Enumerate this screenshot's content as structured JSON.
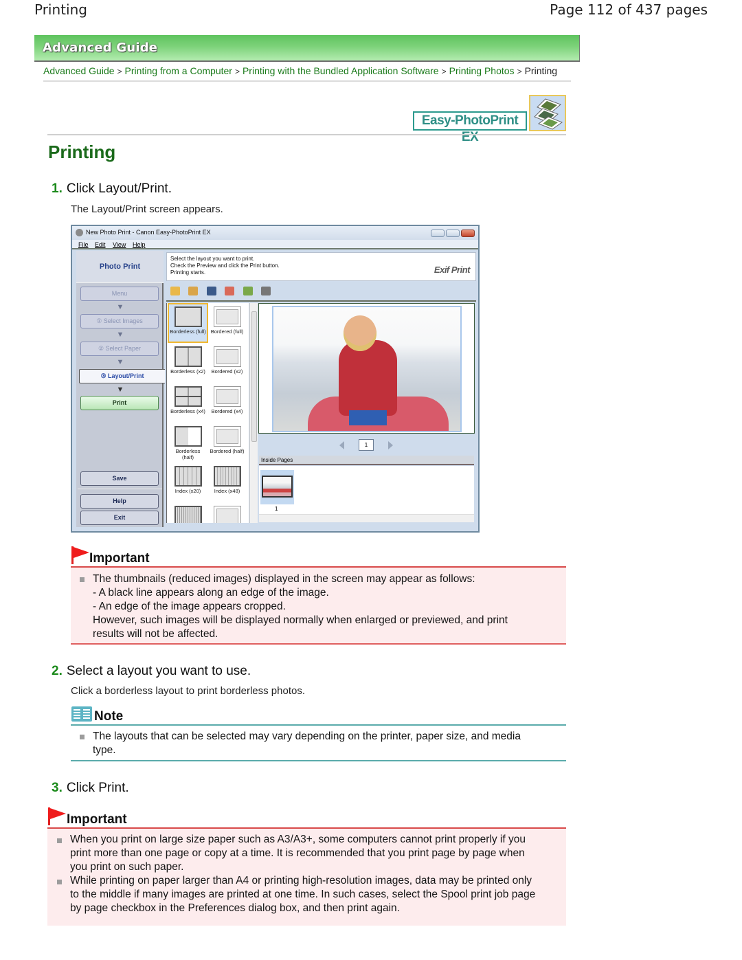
{
  "header": {
    "section": "Printing",
    "page_indicator": "Page 112 of 437 pages"
  },
  "banner": {
    "title": "Advanced Guide"
  },
  "breadcrumb": {
    "items": [
      "Advanced Guide",
      "Printing from a Computer",
      "Printing with the Bundled Application Software",
      "Printing Photos"
    ],
    "separator": ">",
    "current": "Printing"
  },
  "app_logo": {
    "label": "Easy-PhotoPrint EX",
    "icon": "photo-stack-icon"
  },
  "page_title": "Printing",
  "steps": [
    {
      "num": "1.",
      "title": "Click Layout/Print.",
      "desc": "The Layout/Print screen appears."
    },
    {
      "num": "2.",
      "title": "Select a layout you want to use.",
      "desc": "Click a borderless layout to print borderless photos."
    },
    {
      "num": "3.",
      "title": "Click Print.",
      "desc": ""
    }
  ],
  "screenshot": {
    "window_title": "New Photo Print - Canon Easy-PhotoPrint EX",
    "menu": [
      "File",
      "Edit",
      "View",
      "Help"
    ],
    "sidebar": {
      "header": "Photo Print",
      "buttons": [
        "Menu",
        "① Select Images",
        "② Select Paper",
        "③ Layout/Print",
        "Print"
      ],
      "bottom_buttons": [
        "Save",
        "Help",
        "Exit"
      ]
    },
    "instructions": [
      "Select the layout you want to print.",
      "Check the Preview and click the Print button.",
      "Printing starts."
    ],
    "exif_logo": "Exif Print",
    "layouts": [
      {
        "label": "Borderless (full)",
        "selected": true
      },
      {
        "label": "Bordered (full)",
        "selected": false
      },
      {
        "label": "Borderless (x2)",
        "selected": false
      },
      {
        "label": "Bordered (x2)",
        "selected": false
      },
      {
        "label": "Borderless (x4)",
        "selected": false
      },
      {
        "label": "Bordered (x4)",
        "selected": false
      },
      {
        "label": "Borderless (half)",
        "selected": false
      },
      {
        "label": "Bordered (half)",
        "selected": false
      },
      {
        "label": "Index (x20)",
        "selected": false
      },
      {
        "label": "Index (x48)",
        "selected": false
      }
    ],
    "page_number": "1",
    "inside_pages_label": "Inside Pages",
    "thumb_number": "1"
  },
  "important1": {
    "heading": "Important",
    "lines": [
      "The thumbnails (reduced images) displayed in the screen may appear as follows:",
      "- A black line appears along an edge of the image.",
      "- An edge of the image appears cropped.",
      "However, such images will be displayed normally when enlarged or previewed, and print",
      "results will not be affected."
    ]
  },
  "note": {
    "heading": "Note",
    "lines": [
      "The layouts that can be selected may vary depending on the printer, paper size, and media",
      "type."
    ]
  },
  "important2": {
    "heading": "Important",
    "items": [
      [
        "When you print on large size paper such as A3/A3+, some computers cannot print properly if you",
        "print more than one page or copy at a time. It is recommended that you print page by page when",
        "you print on such paper."
      ],
      [
        "While printing on paper larger than A4 or printing high-resolution images, data may be printed only",
        "to the middle if many images are printed at one time. In such cases, select the Spool print job page",
        "by page checkbox in the Preferences dialog box, and then print again."
      ]
    ]
  },
  "colors": {
    "accent_green": "#1b6a1b",
    "banner_green": "#5ec35e",
    "important_red": "#d84a4a",
    "note_teal": "#5aabab"
  }
}
